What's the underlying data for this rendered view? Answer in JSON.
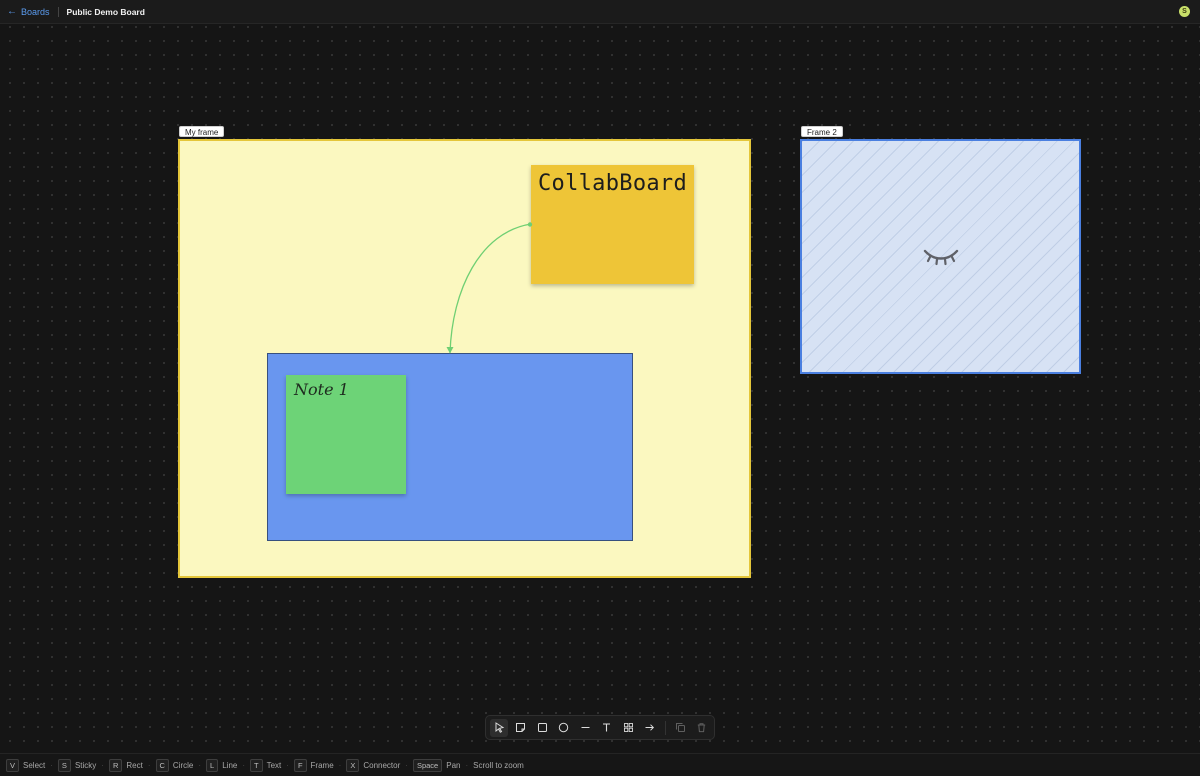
{
  "header": {
    "back_label": "Boards",
    "board_title": "Public Demo Board",
    "avatar_initial": "S"
  },
  "canvas": {
    "frames": [
      {
        "label": "My frame",
        "fill": "#fbf8c0",
        "border": "#e4c63a"
      },
      {
        "label": "Frame 2",
        "fill": "#d7e2f4",
        "border": "#4a7fe0",
        "hidden_icon": "eye-closed-icon"
      }
    ],
    "stickies": [
      {
        "text": "CollabBoard",
        "color": "#eec537"
      },
      {
        "text": "Note 1",
        "color": "#6dd377"
      }
    ],
    "rectangle": {
      "color": "#6996ef"
    },
    "connector": {
      "color": "#6fcf73"
    }
  },
  "toolbar": {
    "tools": [
      {
        "name": "select",
        "icon": "cursor-icon",
        "active": true
      },
      {
        "name": "sticky",
        "icon": "sticky-note-icon"
      },
      {
        "name": "rect",
        "icon": "square-icon"
      },
      {
        "name": "circle",
        "icon": "circle-icon"
      },
      {
        "name": "line",
        "icon": "line-icon"
      },
      {
        "name": "text",
        "icon": "text-icon"
      },
      {
        "name": "frame",
        "icon": "frame-grid-icon"
      },
      {
        "name": "connector",
        "icon": "arrow-right-icon"
      },
      {
        "name": "duplicate",
        "icon": "copy-icon",
        "disabled": true
      },
      {
        "name": "delete",
        "icon": "trash-icon",
        "disabled": true
      }
    ]
  },
  "shortcuts": {
    "items": [
      {
        "key": "V",
        "label": "Select"
      },
      {
        "key": "S",
        "label": "Sticky"
      },
      {
        "key": "R",
        "label": "Rect"
      },
      {
        "key": "C",
        "label": "Circle"
      },
      {
        "key": "L",
        "label": "Line"
      },
      {
        "key": "T",
        "label": "Text"
      },
      {
        "key": "F",
        "label": "Frame"
      },
      {
        "key": "X",
        "label": "Connector"
      },
      {
        "key": "Space",
        "label": "Pan"
      }
    ],
    "scroll_hint": "Scroll to zoom"
  }
}
